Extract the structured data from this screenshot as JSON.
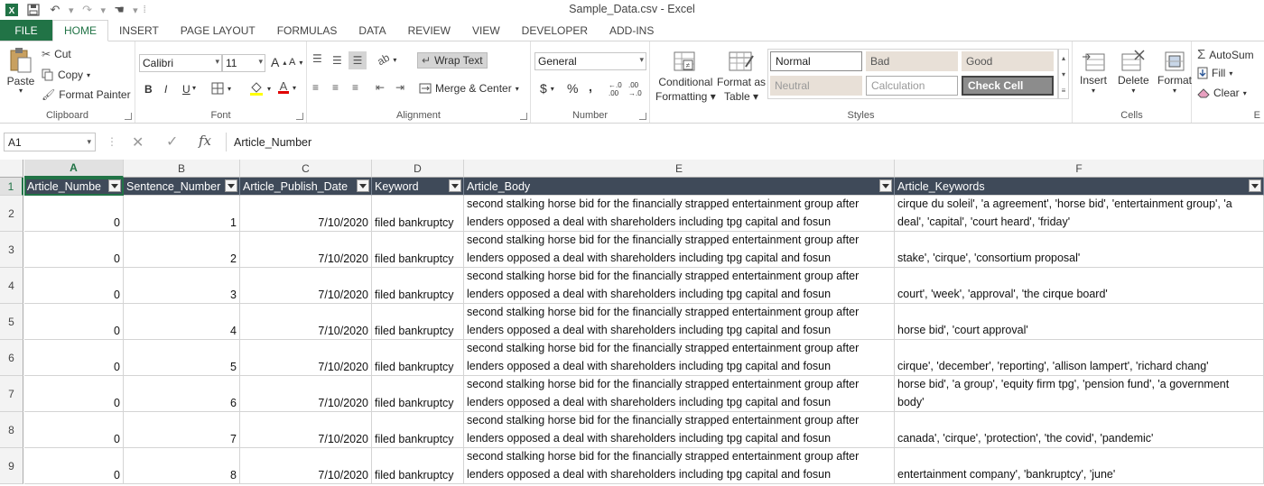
{
  "app": {
    "title": "Sample_Data.csv - Excel"
  },
  "tabs": [
    "FILE",
    "HOME",
    "INSERT",
    "PAGE LAYOUT",
    "FORMULAS",
    "DATA",
    "REVIEW",
    "VIEW",
    "DEVELOPER",
    "ADD-INS"
  ],
  "clipboard": {
    "paste": "Paste",
    "cut": "Cut",
    "copy": "Copy",
    "format_painter": "Format Painter",
    "label": "Clipboard"
  },
  "font": {
    "name": "Calibri",
    "size": "11",
    "label": "Font",
    "bold": "B",
    "italic": "I",
    "underline": "U",
    "grow": "A",
    "shrink": "A"
  },
  "alignment": {
    "wrap_text": "Wrap Text",
    "merge_center": "Merge & Center",
    "label": "Alignment"
  },
  "number": {
    "format": "General",
    "currency": "$",
    "percent": "%",
    "comma": ",",
    "label": "Number",
    "inc_decimal": "←.0 .00",
    "dec_decimal": ".00 →.0"
  },
  "styles": {
    "conditional": [
      "Conditional",
      "Formatting"
    ],
    "format_as_table": [
      "Format as",
      "Table"
    ],
    "cells": [
      {
        "label": "Normal",
        "bg": "#ffffff",
        "fg": "#222222"
      },
      {
        "label": "Bad",
        "bg": "#e8e0d7",
        "fg": "#555555"
      },
      {
        "label": "Good",
        "bg": "#e8e0d7",
        "fg": "#555555"
      },
      {
        "label": "Neutral",
        "bg": "#e8e0d7",
        "fg": "#999999"
      },
      {
        "label": "Calculation",
        "bg": "#ffffff",
        "fg": "#999999"
      },
      {
        "label": "Check Cell",
        "bg": "#8c8c8c",
        "fg": "#ffffff"
      }
    ],
    "label": "Styles"
  },
  "cells_group": {
    "insert": "Insert",
    "delete": "Delete",
    "format": "Format",
    "label": "Cells"
  },
  "editing": {
    "autosum": "AutoSum",
    "fill": "Fill",
    "clear": "Clear",
    "label": "E"
  },
  "formula_bar": {
    "name_box": "A1",
    "formula": "Article_Number"
  },
  "columns": [
    {
      "letter": "A",
      "header": "Article_Numbe"
    },
    {
      "letter": "B",
      "header": "Sentence_Number"
    },
    {
      "letter": "C",
      "header": "Article_Publish_Date"
    },
    {
      "letter": "D",
      "header": "Keyword"
    },
    {
      "letter": "E",
      "header": "Article_Body"
    },
    {
      "letter": "F",
      "header": "Article_Keywords"
    }
  ],
  "body_text": [
    "second stalking horse bid for the financially strapped entertainment group after",
    "lenders opposed a deal with shareholders including tpg capital and fosun"
  ],
  "rows": [
    {
      "num": "2",
      "a": "0",
      "b": "1",
      "c": "7/10/2020",
      "d": "filed bankruptcy",
      "f": [
        "cirque du soleil', 'a agreement', 'horse bid', 'entertainment group', 'a",
        "deal', 'capital', 'court heard', 'friday'"
      ]
    },
    {
      "num": "3",
      "a": "0",
      "b": "2",
      "c": "7/10/2020",
      "d": "filed bankruptcy",
      "f": [
        "",
        "stake', 'cirque', 'consortium proposal'"
      ]
    },
    {
      "num": "4",
      "a": "0",
      "b": "3",
      "c": "7/10/2020",
      "d": "filed bankruptcy",
      "f": [
        "",
        "court', 'week', 'approval', 'the cirque board'"
      ]
    },
    {
      "num": "5",
      "a": "0",
      "b": "4",
      "c": "7/10/2020",
      "d": "filed bankruptcy",
      "f": [
        "",
        "horse bid', 'court approval'"
      ]
    },
    {
      "num": "6",
      "a": "0",
      "b": "5",
      "c": "7/10/2020",
      "d": "filed bankruptcy",
      "f": [
        "",
        "cirque', 'december', 'reporting', 'allison lampert', 'richard chang'"
      ]
    },
    {
      "num": "7",
      "a": "0",
      "b": "6",
      "c": "7/10/2020",
      "d": "filed bankruptcy",
      "f": [
        "horse bid', 'a group', 'equity firm tpg', 'pension fund', 'a government",
        "body'"
      ]
    },
    {
      "num": "8",
      "a": "0",
      "b": "7",
      "c": "7/10/2020",
      "d": "filed bankruptcy",
      "f": [
        "",
        "canada', 'cirque', 'protection', 'the covid', 'pandemic'"
      ]
    },
    {
      "num": "9",
      "a": "0",
      "b": "8",
      "c": "7/10/2020",
      "d": "filed bankruptcy",
      "f": [
        "",
        "entertainment company', 'bankruptcy', 'june'"
      ]
    }
  ],
  "colors": {
    "accent": "#217346",
    "header_bg": "#3f4a59"
  }
}
